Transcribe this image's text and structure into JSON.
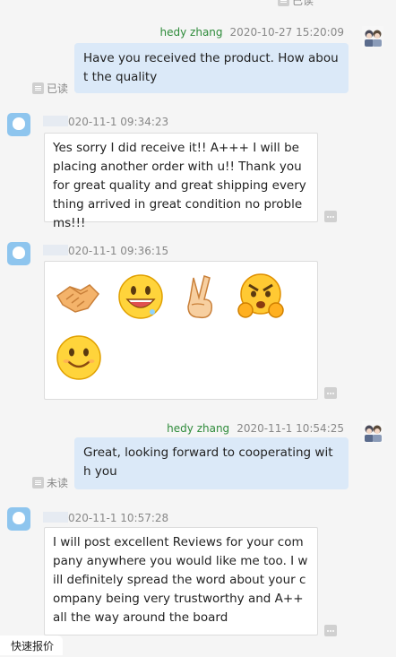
{
  "top_receipt": "已读",
  "messages": [
    {
      "sender": "hedy zhang",
      "time": "2020-10-27 15:20:09",
      "text": "Have you received the product. How about the quality",
      "receipt": "已读"
    },
    {
      "time": "020-11-1 09:34:23",
      "text": "Yes sorry I did receive it!! A+++ I will be placing another order with u!! Thank you for great quality and great shipping everything arrived in great condition no problems!!!"
    },
    {
      "time": "020-11-1 09:36:15",
      "emojis": [
        "handshake",
        "grin-drool",
        "victory-hand",
        "angry-fists",
        "smile"
      ]
    },
    {
      "sender": "hedy zhang",
      "time": "2020-11-1 10:54:25",
      "text": "Great, looking forward to cooperating with you",
      "receipt": "未读"
    },
    {
      "time": "020-11-1 10:57:28",
      "text": "I will post excellent Reviews for your company anywhere you would like me too. I will definitely spread the word about your company being very trustworthy and A++ all the way around the board"
    }
  ],
  "footer": {
    "tab_label": "快速报价"
  }
}
